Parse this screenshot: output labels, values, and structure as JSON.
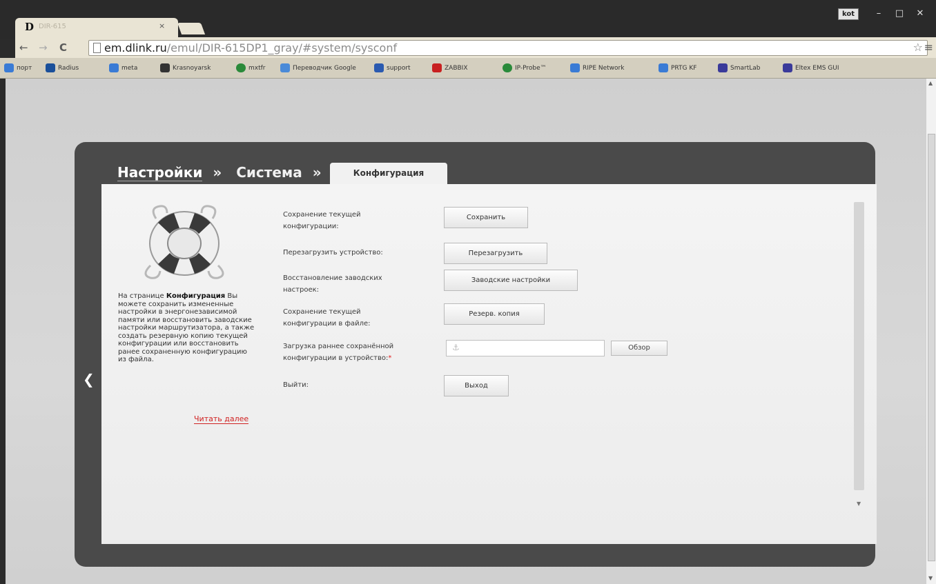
{
  "browser": {
    "tab_logo": "D",
    "tab_title": "DIR-615",
    "tab_close": "×",
    "user_badge": "kot",
    "window_controls": [
      "–",
      "□",
      "✕"
    ],
    "nav": {
      "back": "←",
      "forward": "→",
      "reload": "C"
    },
    "url": {
      "host": "em.dlink.ru",
      "path": "/emul/DIR-615DP1_gray/#system/sysconf"
    },
    "star": "☆",
    "menu": "≡"
  },
  "bookmarks": [
    {
      "label": "порт",
      "color": "#3a7bd5"
    },
    {
      "label": "Radius",
      "color": "#1a4f9a"
    },
    {
      "label": "meta",
      "color": "#3a7bd5"
    },
    {
      "label": "Krasnoyarsk",
      "color": "#333333"
    },
    {
      "label": "mxtfr",
      "color": "#2a8a3a"
    },
    {
      "label": "Переводчик Google",
      "color": "#4a8ad8"
    },
    {
      "label": "support",
      "color": "#2a5ab0"
    },
    {
      "label": "ZABBIX",
      "color": "#c82020"
    },
    {
      "label": "IP-Probe™",
      "color": "#2a8a3a"
    },
    {
      "label": "RIPE Network",
      "color": "#3a7bd5"
    },
    {
      "label": "PRTG KF",
      "color": "#3a7bd5"
    },
    {
      "label": "SmartLab",
      "color": "#3a3a9a"
    },
    {
      "label": "Eltex EMS GUI",
      "color": "#3a3a9a"
    }
  ],
  "page": {
    "breadcrumb": {
      "level1": "Настройки",
      "sep1": "»",
      "level2": "Система",
      "sep2": "»",
      "current": "Конфигурация"
    },
    "back_arrow": "❮",
    "sidebar": {
      "desc_prefix": "На странице ",
      "desc_bold": "Конфигурация",
      "desc_rest": " Вы можете сохранить измененные настройки в энергонезависимой памяти или восстановить заводские настройки маршрутизатора, а также создать резервную копию текущей конфигурации или восстановить ранее сохраненную конфигурацию из файла.",
      "read_more": "Читать далее"
    },
    "rows": {
      "save": {
        "label": "Сохранение текущей конфигурации:",
        "button": "Сохранить"
      },
      "reboot": {
        "label": "Перезагрузить устройство:",
        "button": "Перезагрузить"
      },
      "factory": {
        "label": "Восстановление заводских настроек:",
        "button": "Заводские настройки"
      },
      "backup": {
        "label": "Сохранение текущей конфигурации в файле:",
        "button": "Резерв. копия"
      },
      "upload": {
        "label": "Загрузка раннее сохранённой конфигурации в устройство:",
        "required_mark": "*",
        "browse": "Обзор",
        "file_value": ""
      },
      "logout": {
        "label": "Выйти:",
        "button": "Выход"
      }
    }
  }
}
